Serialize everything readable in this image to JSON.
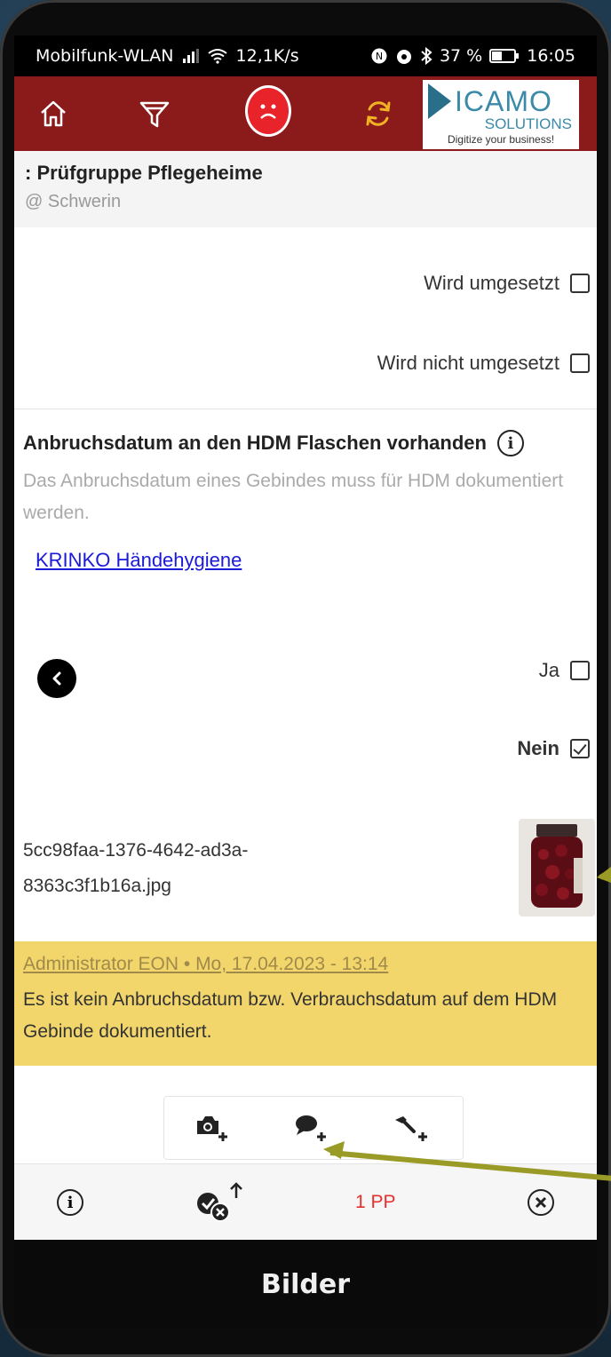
{
  "statusbar": {
    "carrier": "Mobilfunk-WLAN",
    "speed": "12,1K/s",
    "battery": "37 %",
    "time": "16:05"
  },
  "toolbar": {
    "icons": [
      "home-icon",
      "filter-icon",
      "sad-face-icon",
      "sync-icon"
    ],
    "logo": {
      "name": "ICAMO",
      "subname": "SOLUTIONS",
      "tagline": "Digitize your business!"
    }
  },
  "header": {
    "title": ": Prüfgruppe Pflegeheime",
    "location": "@ Schwerin"
  },
  "options": [
    {
      "label": "Wird umgesetzt",
      "checked": false
    },
    {
      "label": "Wird nicht umgesetzt",
      "checked": false
    }
  ],
  "question": {
    "title": "Anbruchsdatum an den HDM Flaschen vorhanden",
    "description": "Das Anbruchsdatum eines Gebindes muss für HDM dokumentiert werden.",
    "link": "KRINKO Händehygiene"
  },
  "answers": [
    {
      "label": "Ja",
      "checked": false
    },
    {
      "label": "Nein",
      "checked": true
    }
  ],
  "attachment": {
    "filename": "5cc98faa-1376-4642-ad3a-8363c3f1b16a.jpg"
  },
  "comment": {
    "meta": "Administrator EON • Mo, 17.04.2023 - 13:14",
    "text": "Es ist kein Anbruchsdatum bzw. Verbrauchsdatum auf dem HDM Gebinde dokumentiert."
  },
  "actions": [
    "add-photo-icon",
    "add-comment-icon",
    "add-task-icon"
  ],
  "bottombar": {
    "pp_label": "1 PP"
  },
  "navbar": {
    "label": "Bilder"
  },
  "colors": {
    "toolbar": "#8b1a1a",
    "comment_bg": "#f2d66c",
    "link": "#1a1ad8",
    "pp": "#e53030",
    "arrow": "#9a9a26"
  }
}
